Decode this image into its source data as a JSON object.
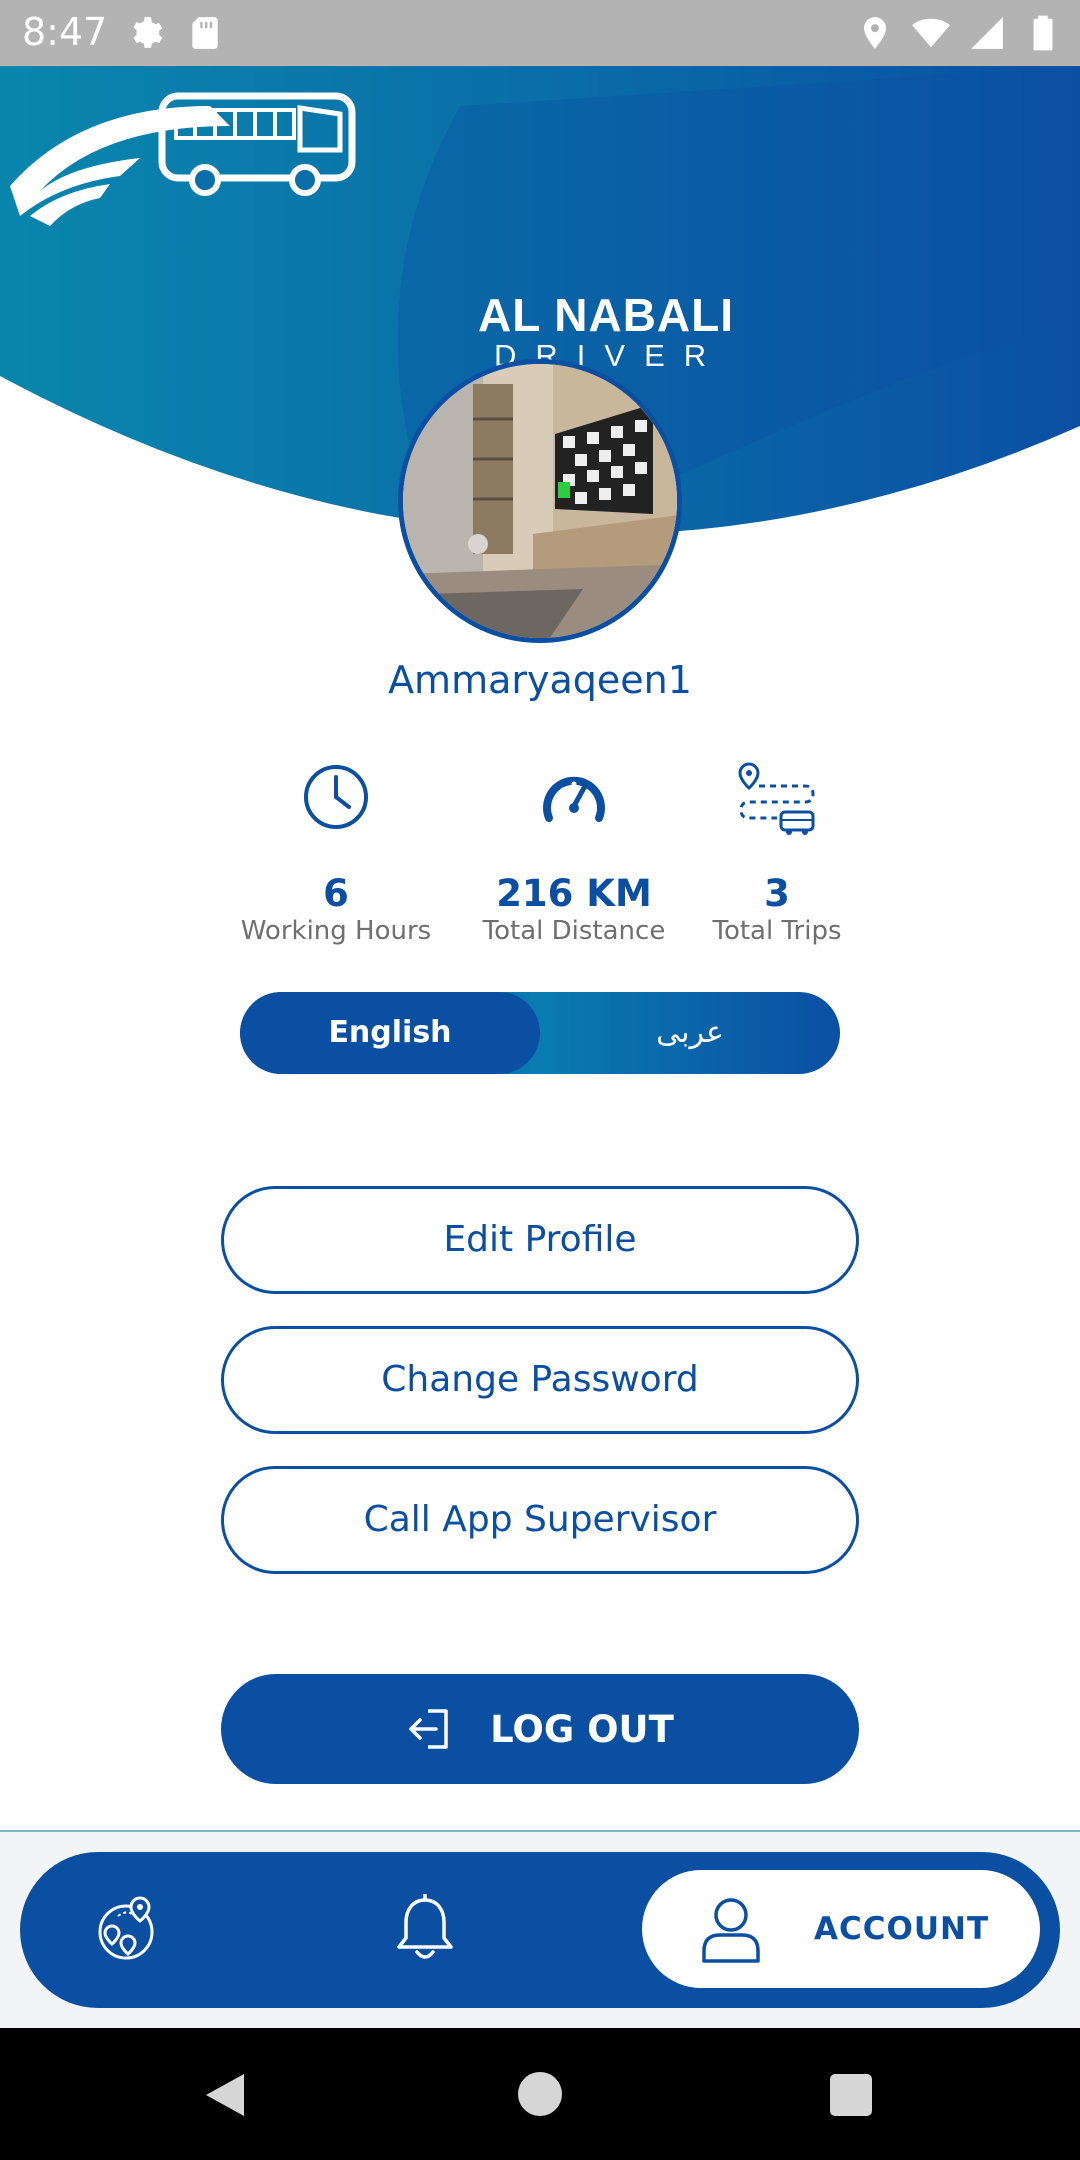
{
  "status_bar": {
    "time": "8:47",
    "icons_left": [
      "settings-icon",
      "sd-card-icon"
    ],
    "icons_right": [
      "location-icon",
      "wifi-icon",
      "signal-icon",
      "battery-icon"
    ]
  },
  "brand": {
    "name": "AL NABALI",
    "subtitle": "DRIVER",
    "primary_color": "#0b4fa3",
    "accent_color": "#0a86ad"
  },
  "profile": {
    "username": "Ammaryaqeen1"
  },
  "stats": [
    {
      "icon": "clock-icon",
      "value": "6",
      "label": "Working Hours"
    },
    {
      "icon": "speedometer-icon",
      "value": "216 KM",
      "label": "Total Distance"
    },
    {
      "icon": "route-bus-icon",
      "value": "3",
      "label": "Total Trips"
    }
  ],
  "language": {
    "selected": "English",
    "other": "عربى"
  },
  "actions": {
    "edit_profile": "Edit Profile",
    "change_password": "Change Password",
    "call_supervisor": "Call App Supervisor",
    "logout": "LOG OUT"
  },
  "bottom_nav": {
    "items": [
      "map-pins-icon",
      "bell-icon"
    ],
    "active_label": "ACCOUNT"
  }
}
